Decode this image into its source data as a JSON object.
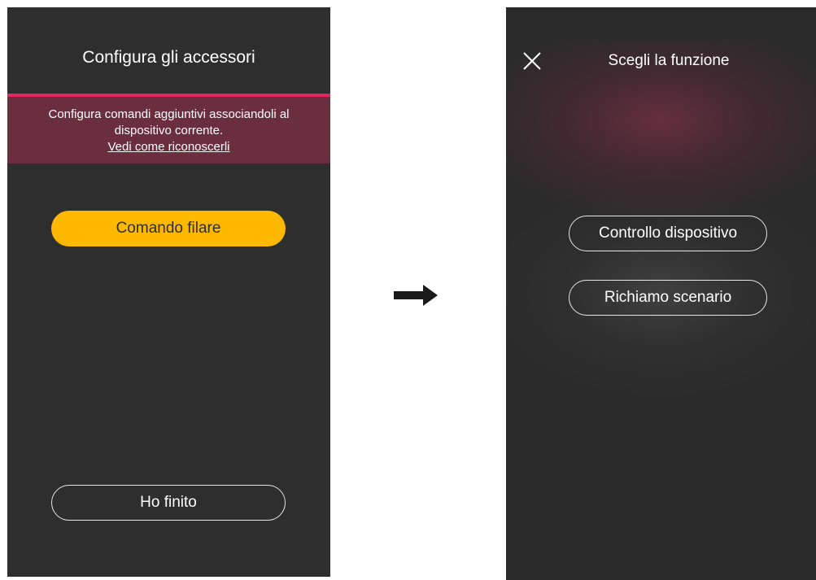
{
  "left_screen": {
    "title": "Configura gli accessori",
    "info_line_1": "Configura comandi aggiuntivi associandoli al",
    "info_line_2": "dispositivo corrente.",
    "info_link": "Vedi come riconoscerli",
    "primary_button": "Comando filare",
    "finish_button": "Ho finito",
    "colors": {
      "background": "#2e2e2e",
      "accent_line": "#e8245a",
      "info_band": "#6b2d40",
      "primary_button": "#ffb800"
    }
  },
  "arrow_icon": "right-arrow-icon",
  "right_screen": {
    "close_icon": "close-icon",
    "title": "Scegli la funzione",
    "options": [
      {
        "label": "Controllo dispositivo"
      },
      {
        "label": "Richiamo scenario"
      }
    ],
    "colors": {
      "background": "#2a2a2a",
      "glow": "#963250"
    }
  }
}
